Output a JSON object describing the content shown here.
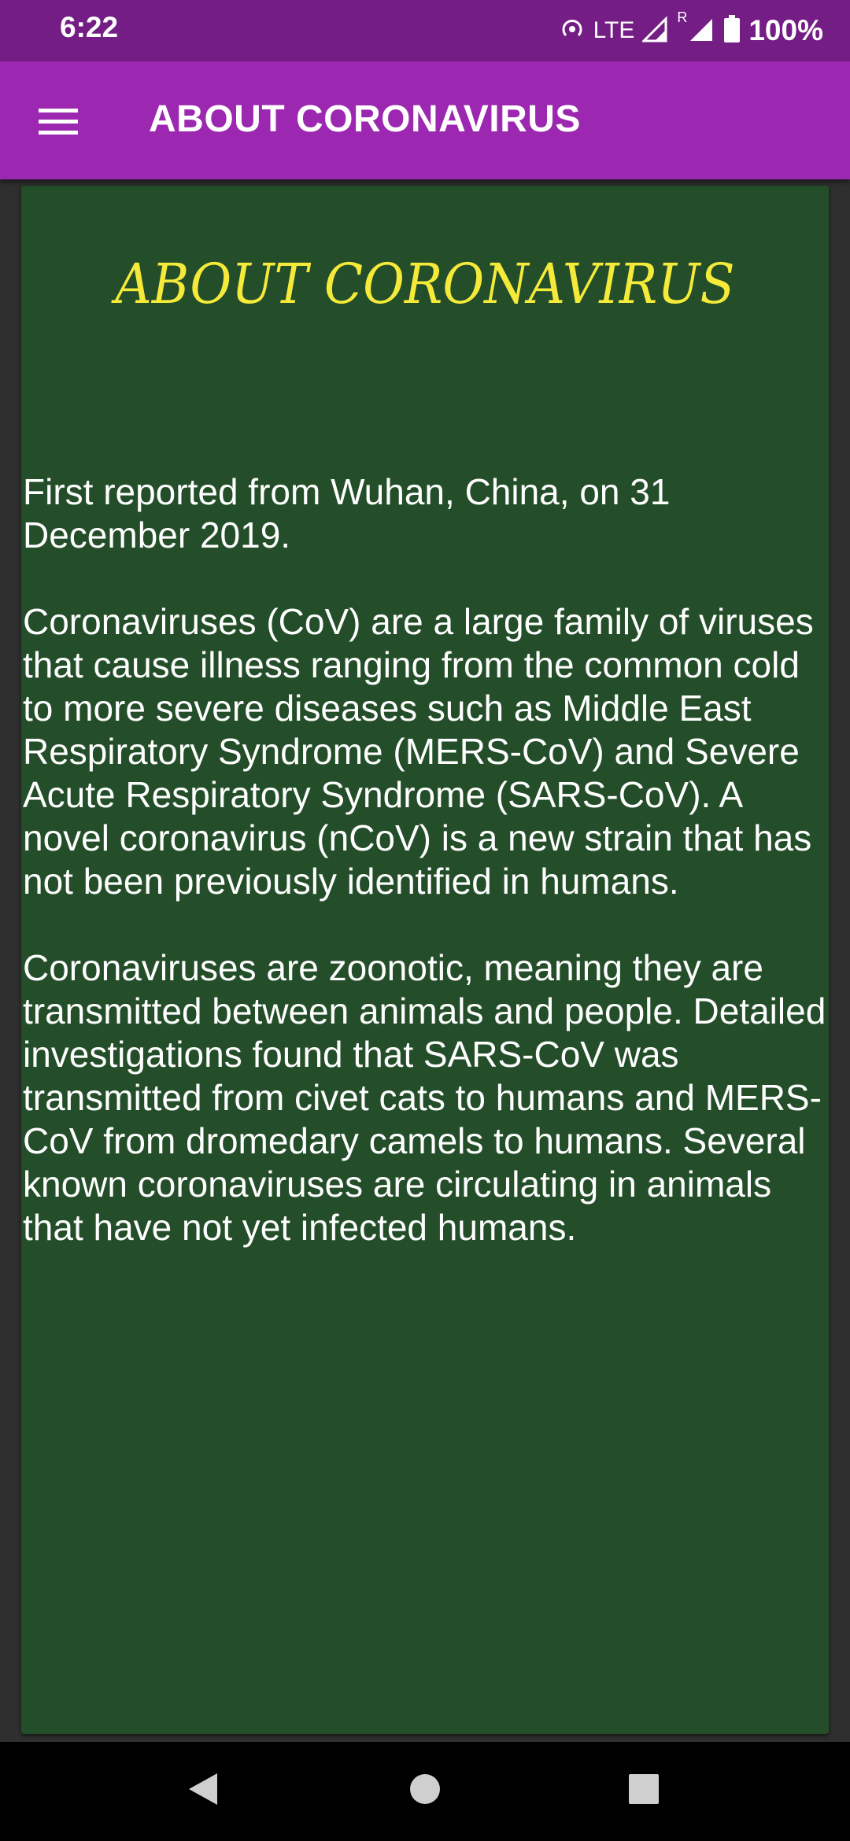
{
  "status_bar": {
    "time": "6:22",
    "network": "LTE",
    "roaming": "R",
    "battery": "100%"
  },
  "app_bar": {
    "title": "ABOUT CORONAVIRUS",
    "menu_icon": "hamburger-menu-icon"
  },
  "content": {
    "heading": "ABOUT CORONAVIRUS",
    "paragraphs": [
      "First reported from Wuhan, China, on 31 December 2019.",
      "Coronaviruses (CoV) are a large family of viruses that cause illness ranging from the common cold to more severe diseases such as Middle East Respiratory Syndrome (MERS-CoV) and Severe Acute Respiratory Syndrome (SARS-CoV). A novel coronavirus (nCoV) is a new strain that has not been previously identified in humans.",
      "Coronaviruses are zoonotic, meaning they are transmitted between animals and people. Detailed investigations found that SARS-CoV was transmitted from civet cats to humans and MERS-CoV from dromedary camels to humans. Several known coronaviruses are circulating in animals that have not yet infected humans."
    ]
  },
  "nav_bar": {
    "back_icon": "back-triangle-icon",
    "home_icon": "home-circle-icon",
    "recents_icon": "recents-square-icon"
  },
  "colors": {
    "status_bar": "#731d85",
    "app_bar": "#9c27b0",
    "card_background": "#234e29",
    "heading": "#f5ea3a",
    "body_text": "#ffffff"
  }
}
